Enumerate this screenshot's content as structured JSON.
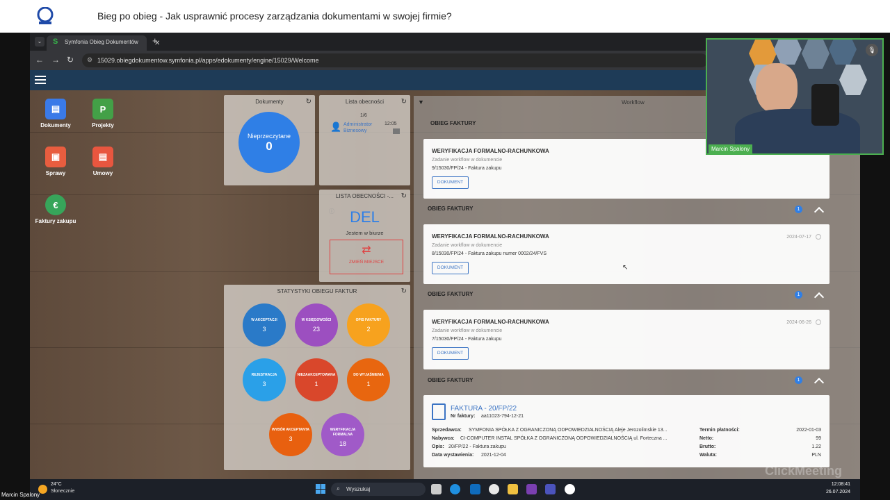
{
  "meeting": {
    "title": "Bieg po obieg - Jak usprawnić procesy zarządzania dokumentami w swojej firmie?",
    "presenter": "Marcin Spalony",
    "watermark": "ClickMeeting"
  },
  "browser": {
    "tab_title": "Symfonia Obieg Dokumentów",
    "url": "15029.obiegdokumentow.symfonia.pl/apps/edokumenty/engine/15029/Welcome"
  },
  "apps": [
    {
      "label": "Dokumenty",
      "color": "#3a7ae8",
      "icon": "document-icon"
    },
    {
      "label": "Projekty",
      "color": "#43a047",
      "icon": "project-icon"
    },
    {
      "label": "Sprawy",
      "color": "#e85d3f",
      "icon": "case-icon"
    },
    {
      "label": "Umowy",
      "color": "#e8563f",
      "icon": "contract-icon"
    },
    {
      "label": "Faktury zakupu",
      "color": "#37a55a",
      "icon": "invoice-icon"
    }
  ],
  "dokumenty": {
    "title": "Dokumenty",
    "circle_label": "Nieprzeczytane",
    "circle_value": "0"
  },
  "lista": {
    "title": "Lista obecności",
    "page": "1/6",
    "user": "Administrator Biznesowy",
    "time": "12:05"
  },
  "lista2": {
    "title": "LISTA OBECNOŚCI -...",
    "code": "DEL",
    "status": "Jestem w biurze",
    "change_label": "ZMIEŃ MIEJSCE"
  },
  "stats": {
    "title": "STATYSTYKI OBIEGU FAKTUR",
    "items": [
      {
        "label": "W AKCEPTACJI",
        "value": "3",
        "color": "#2a7ac8"
      },
      {
        "label": "W KSIĘGOWOŚCI",
        "value": "23",
        "color": "#9c4fc0"
      },
      {
        "label": "OPIS FAKTURY",
        "value": "2",
        "color": "#f7a21e"
      },
      {
        "label": "REJESTRACJA",
        "value": "3",
        "color": "#2aa0e8"
      },
      {
        "label": "NIEZAAKCEPTOWANA",
        "value": "1",
        "color": "#d9472b"
      },
      {
        "label": "DO WYJAŚNIENIA",
        "value": "1",
        "color": "#e8660f"
      },
      {
        "label": "WYBÓR AKCEPTANTA",
        "value": "3",
        "color": "#e8600f"
      },
      {
        "label": "WERYFIKACJA FORMALNA",
        "value": "18",
        "color": "#a05ac8"
      }
    ]
  },
  "workflow": {
    "title": "Workflow",
    "groups": [
      {
        "head": "OBIEG FAKTURY",
        "badge": "",
        "title": "WERYFIKACJA FORMALNO-RACHUNKOWA",
        "sub": "Zadanie workflow w dokumencie",
        "doc": "9/15030/FP/24 - Faktura zakupu",
        "date": "",
        "btn": "DOKUMENT"
      },
      {
        "head": "OBIEG FAKTURY",
        "badge": "1",
        "title": "WERYFIKACJA FORMALNO-RACHUNKOWA",
        "sub": "Zadanie workflow w dokumencie",
        "doc": "8/15030/FP/24 - Faktura zakupu numer 0002/24/FVS",
        "date": "2024-07-17",
        "btn": "DOKUMENT"
      },
      {
        "head": "OBIEG FAKTURY",
        "badge": "1",
        "title": "WERYFIKACJA FORMALNO-RACHUNKOWA",
        "sub": "Zadanie workflow w dokumencie",
        "doc": "7/15030/FP/24 - Faktura zakupu",
        "date": "2024-06-26",
        "btn": "DOKUMENT"
      }
    ],
    "invoice_head": "OBIEG FAKTURY",
    "invoice_badge": "1",
    "invoice": {
      "title": "FAKTURA - 20/FP/22",
      "nr_label": "Nr faktury:",
      "nr": "aa11023-794-12-21",
      "seller_label": "Sprzedawca:",
      "seller": "SYMFONIA SPÓŁKA Z OGRANICZONĄ ODPOWIEDZIALNOŚCIĄ Aleje Jerozolimskie 13...",
      "buyer_label": "Nabywca:",
      "buyer": "CI-COMPUTER INSTAL SPÓŁKA Z OGRANICZONĄ ODPOWIEDZIALNOŚCIĄ ul. Forteczna ...",
      "desc_label": "Opis:",
      "desc": "20/FP/22 - Faktura zakupu",
      "issue_label": "Data wystawienia:",
      "issue": "2021-12-04",
      "due_label": "Termin płatności:",
      "due": "2022-01-03",
      "net_label": "Netto:",
      "net": "99",
      "gross_label": "Brutto:",
      "gross": "1.22",
      "cur_label": "Waluta:",
      "cur": "PLN"
    }
  },
  "taskbar": {
    "temp": "24°C",
    "weather": "Słonecznie",
    "search": "Wyszukaj",
    "time": "12:08:41",
    "date": "26.07.2024"
  }
}
